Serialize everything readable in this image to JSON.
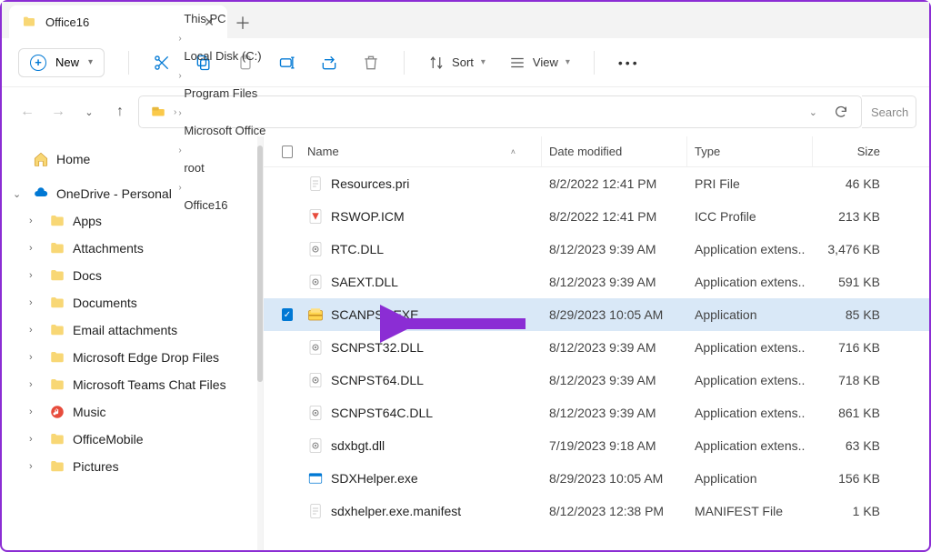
{
  "tab": {
    "title": "Office16"
  },
  "toolbar": {
    "new": "New",
    "sort": "Sort",
    "view": "View"
  },
  "breadcrumb": [
    "This PC",
    "Local Disk (C:)",
    "Program Files",
    "Microsoft Office",
    "root",
    "Office16"
  ],
  "search_placeholder": "Search",
  "sidebar": {
    "home": "Home",
    "onedrive": "OneDrive - Personal",
    "items": [
      "Apps",
      "Attachments",
      "Docs",
      "Documents",
      "Email attachments",
      "Microsoft Edge Drop Files",
      "Microsoft Teams Chat Files",
      "Music",
      "OfficeMobile",
      "Pictures"
    ]
  },
  "columns": {
    "name": "Name",
    "date": "Date modified",
    "type": "Type",
    "size": "Size"
  },
  "files": [
    {
      "name": "Resources.pri",
      "date": "8/2/2022 12:41 PM",
      "type": "PRI File",
      "size": "46 KB",
      "icon": "file",
      "selected": false
    },
    {
      "name": "RSWOP.ICM",
      "date": "8/2/2022 12:41 PM",
      "type": "ICC Profile",
      "size": "213 KB",
      "icon": "icc",
      "selected": false
    },
    {
      "name": "RTC.DLL",
      "date": "8/12/2023 9:39 AM",
      "type": "Application extens..",
      "size": "3,476 KB",
      "icon": "dll",
      "selected": false
    },
    {
      "name": "SAEXT.DLL",
      "date": "8/12/2023 9:39 AM",
      "type": "Application extens..",
      "size": "591 KB",
      "icon": "dll",
      "selected": false
    },
    {
      "name": "SCANPST.EXE",
      "date": "8/29/2023 10:05 AM",
      "type": "Application",
      "size": "85 KB",
      "icon": "exe-pst",
      "selected": true
    },
    {
      "name": "SCNPST32.DLL",
      "date": "8/12/2023 9:39 AM",
      "type": "Application extens..",
      "size": "716 KB",
      "icon": "dll",
      "selected": false
    },
    {
      "name": "SCNPST64.DLL",
      "date": "8/12/2023 9:39 AM",
      "type": "Application extens..",
      "size": "718 KB",
      "icon": "dll",
      "selected": false
    },
    {
      "name": "SCNPST64C.DLL",
      "date": "8/12/2023 9:39 AM",
      "type": "Application extens..",
      "size": "861 KB",
      "icon": "dll",
      "selected": false
    },
    {
      "name": "sdxbgt.dll",
      "date": "7/19/2023 9:18 AM",
      "type": "Application extens..",
      "size": "63 KB",
      "icon": "dll",
      "selected": false
    },
    {
      "name": "SDXHelper.exe",
      "date": "8/29/2023 10:05 AM",
      "type": "Application",
      "size": "156 KB",
      "icon": "exe",
      "selected": false
    },
    {
      "name": "sdxhelper.exe.manifest",
      "date": "8/12/2023 12:38 PM",
      "type": "MANIFEST File",
      "size": "1 KB",
      "icon": "file",
      "selected": false
    }
  ]
}
